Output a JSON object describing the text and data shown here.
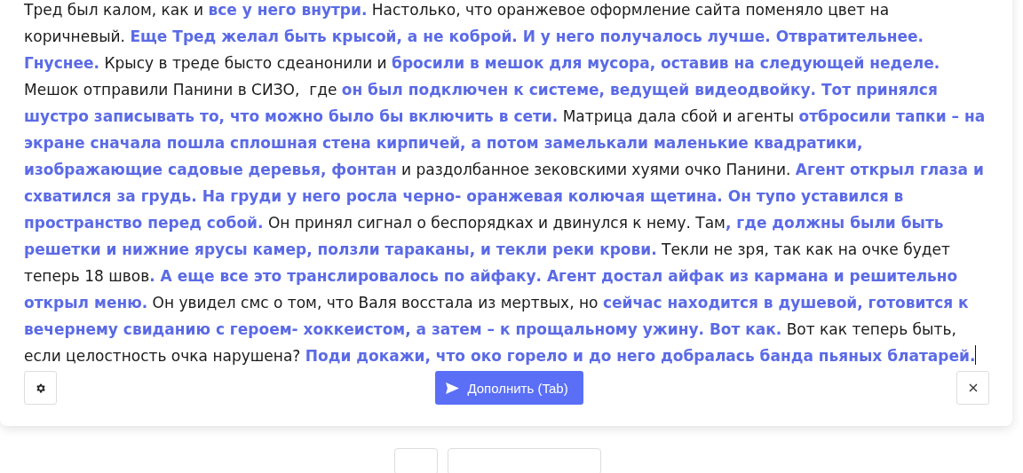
{
  "editor": {
    "text": "Тред был калом, как и **все у него внутри.** Настолько, что оранжевое оформление сайта поменяло цвет на коричневый. **Еще Тред желал быть крысой, а не коброй. И у него получалось лучше. Отвратительнее. Гнуснее.** Крысу в треде бысто сдеанонили и **бросили в мешок для мусора, оставив на следующей неделе.** Мешок отправили Панини в СИЗО,  где **он был подключен к системе, ведущей видеодвойку. Тот принялся шустро записывать то, что можно было бы включить в сети.** Матрица дала сбой и агенты **отбросили тапки – на экране сначала пошла сплошная стена кирпичей, а потом замелькали маленькие квадратики, изображающие садовые деревья, фонтан** и раздолбанное зековскими хуями очко Панини. **Агент открыл глаза и схватился за грудь. На груди у него росла черно- оранжевая колючая щетина. Он тупо уставился в пространство перед собой.** Он принял сигнал о беспорядках и двинулся к нему. Там**, где должны были быть решетки и нижние ярусы камер, ползли тараканы, и текли реки крови.** Текли не зря, так как на очке будет теперь 18 швов**. А еще все это транслировалось по айфаку. Агент достал айфак из кармана и решительно открыл меню.** Он увидел смс о том, что Валя восстала из мертвых, но **сейчас находится в душевой, готовится к вечернему свиданию с героем- хоккеистом, а затем – к прощальному ужину. Вот как.** Вот как теперь быть, если целостность очка нарушена? **Поди докажи, что око горело и до него добралась банда пьяных блатарей.**"
  },
  "toolbar": [
    {
      "kind": "settings"
    },
    {
      "kind": "primary",
      "label": "Дополнить (Tab)"
    },
    {
      "kind": "close"
    }
  ],
  "footer_buttons": [
    {
      "kind": "small"
    },
    {
      "kind": "wide"
    }
  ]
}
